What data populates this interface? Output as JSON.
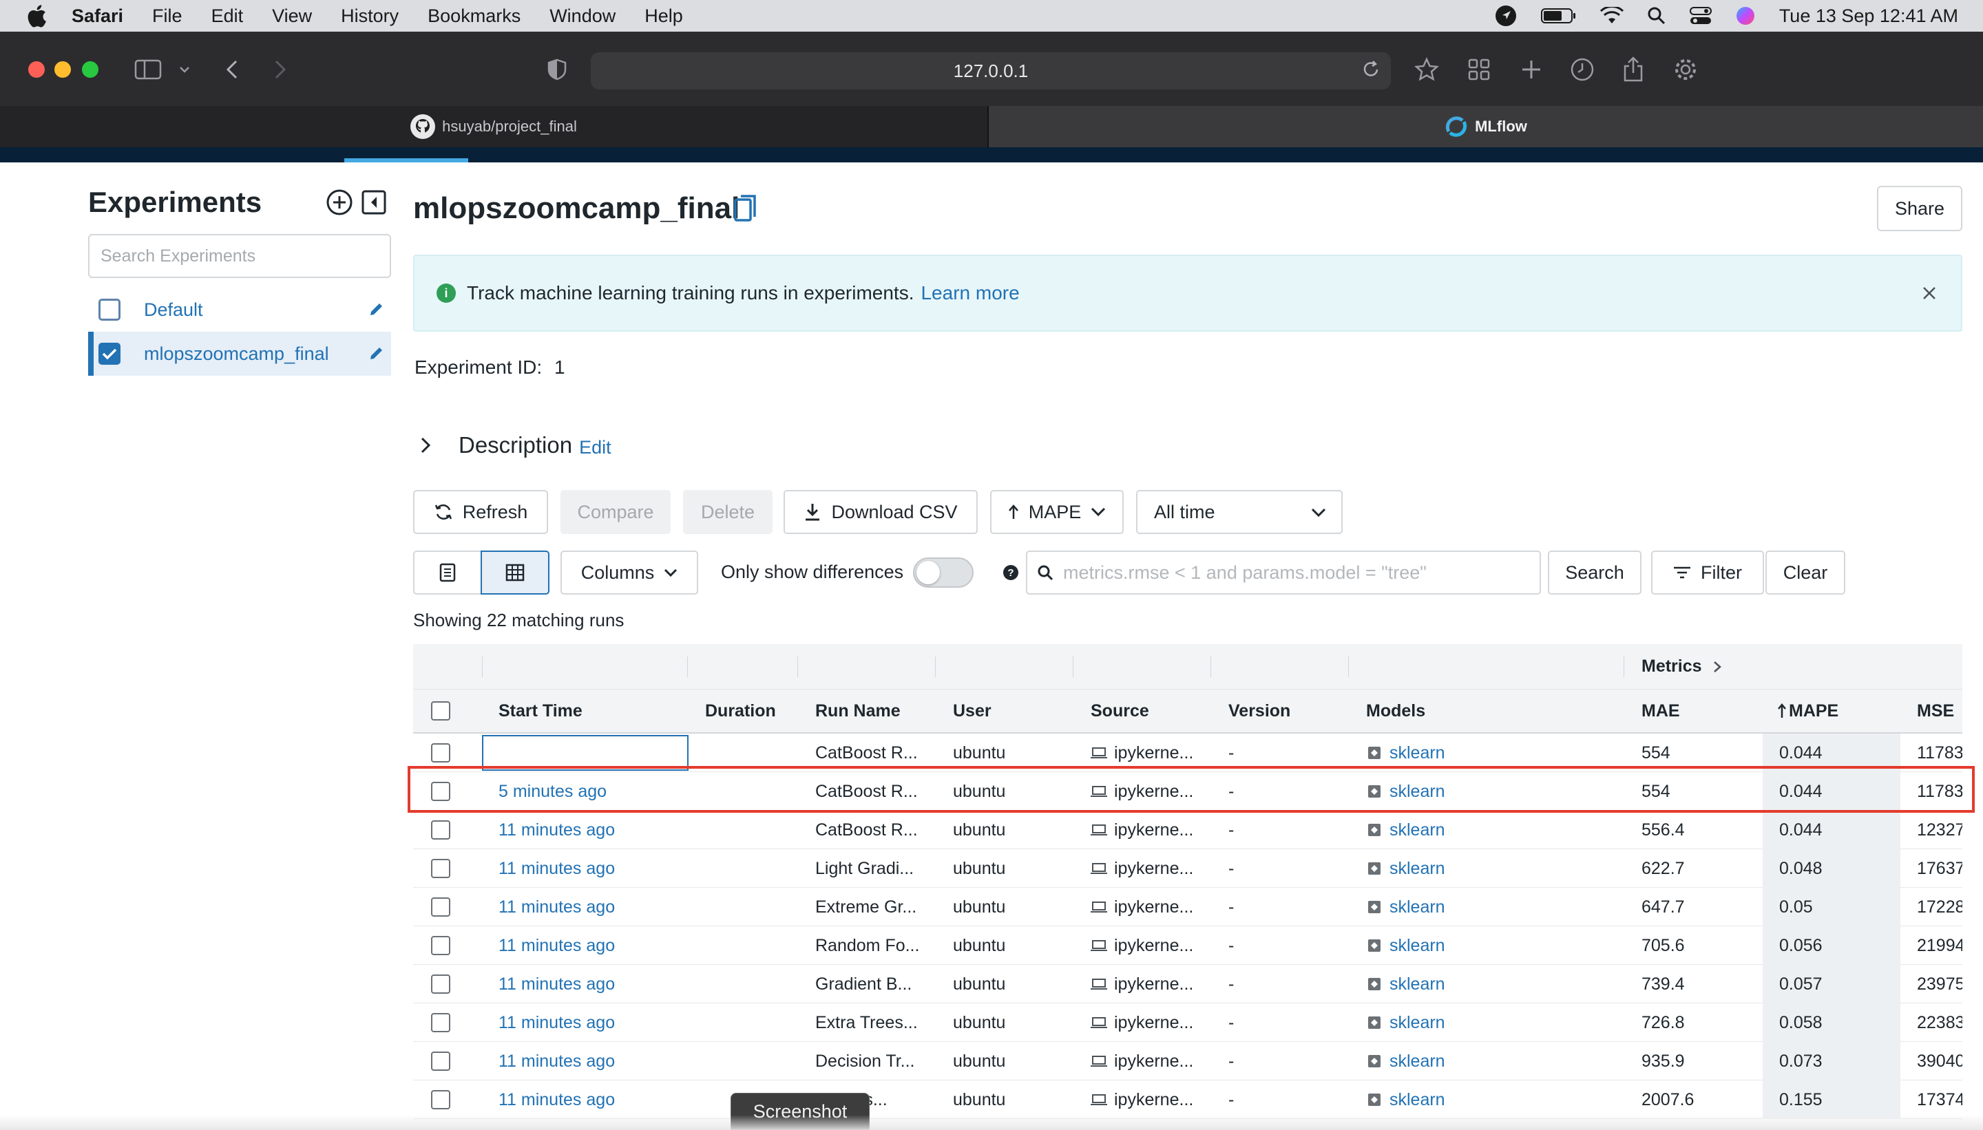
{
  "menubar": {
    "app": "Safari",
    "items": [
      "File",
      "Edit",
      "View",
      "History",
      "Bookmarks",
      "Window",
      "Help"
    ],
    "clock": "Tue 13 Sep  12:41 AM"
  },
  "browser": {
    "url": "127.0.0.1",
    "tabs": [
      {
        "label": "hsuyab/project_final",
        "icon": "github-icon"
      },
      {
        "label": "MLflow",
        "icon": "mlflow-icon"
      }
    ]
  },
  "sidebar": {
    "title": "Experiments",
    "search_placeholder": "Search Experiments",
    "items": [
      {
        "label": "Default",
        "checked": false
      },
      {
        "label": "mlopszoomcamp_final",
        "checked": true
      }
    ]
  },
  "main": {
    "title": "mlopszoomcamp_final",
    "share_label": "Share",
    "banner": {
      "text": "Track machine learning training runs in experiments.",
      "link": "Learn more"
    },
    "experiment_id_label": "Experiment ID:",
    "experiment_id": "1",
    "description_label": "Description",
    "edit_label": "Edit"
  },
  "controls": {
    "refresh": "Refresh",
    "compare": "Compare",
    "delete": "Delete",
    "download_csv": "Download CSV",
    "sort": "MAPE",
    "time_range": "All time",
    "columns": "Columns",
    "only_diff": "Only show differences",
    "only_diff_on": false,
    "search_placeholder": "metrics.rmse < 1 and params.model = \"tree\"",
    "search": "Search",
    "filter": "Filter",
    "clear": "Clear",
    "showing": "Showing 22 matching runs"
  },
  "table": {
    "group_header": "Metrics",
    "headers": [
      "Start Time",
      "Duration",
      "Run Name",
      "User",
      "Source",
      "Version",
      "Models",
      "MAE",
      "MAPE",
      "MSE"
    ],
    "rows": [
      {
        "start": "",
        "run": "CatBoost R...",
        "user": "ubuntu",
        "source": "ipykerne...",
        "version": "-",
        "model": "sklearn",
        "mae": "554",
        "mape": "0.044",
        "mse": "11783"
      },
      {
        "start": "5 minutes ago",
        "run": "CatBoost R...",
        "user": "ubuntu",
        "source": "ipykerne...",
        "version": "-",
        "model": "sklearn",
        "mae": "554",
        "mape": "0.044",
        "mse": "11783"
      },
      {
        "start": "11 minutes ago",
        "run": "CatBoost R...",
        "user": "ubuntu",
        "source": "ipykerne...",
        "version": "-",
        "model": "sklearn",
        "mae": "556.4",
        "mape": "0.044",
        "mse": "12327"
      },
      {
        "start": "11 minutes ago",
        "run": "Light Gradi...",
        "user": "ubuntu",
        "source": "ipykerne...",
        "version": "-",
        "model": "sklearn",
        "mae": "622.7",
        "mape": "0.048",
        "mse": "17637"
      },
      {
        "start": "11 minutes ago",
        "run": "Extreme Gr...",
        "user": "ubuntu",
        "source": "ipykerne...",
        "version": "-",
        "model": "sklearn",
        "mae": "647.7",
        "mape": "0.05",
        "mse": "17228"
      },
      {
        "start": "11 minutes ago",
        "run": "Random Fo...",
        "user": "ubuntu",
        "source": "ipykerne...",
        "version": "-",
        "model": "sklearn",
        "mae": "705.6",
        "mape": "0.056",
        "mse": "21994"
      },
      {
        "start": "11 minutes ago",
        "run": "Gradient B...",
        "user": "ubuntu",
        "source": "ipykerne...",
        "version": "-",
        "model": "sklearn",
        "mae": "739.4",
        "mape": "0.057",
        "mse": "23975"
      },
      {
        "start": "11 minutes ago",
        "run": "Extra Trees...",
        "user": "ubuntu",
        "source": "ipykerne...",
        "version": "-",
        "model": "sklearn",
        "mae": "726.8",
        "mape": "0.058",
        "mse": "22383"
      },
      {
        "start": "11 minutes ago",
        "run": "Decision Tr...",
        "user": "ubuntu",
        "source": "ipykerne...",
        "version": "-",
        "model": "sklearn",
        "mae": "935.9",
        "mape": "0.073",
        "mse": "39040"
      },
      {
        "start": "11 minutes ago",
        "run": "...Trans...",
        "user": "ubuntu",
        "source": "ipykerne...",
        "version": "-",
        "model": "sklearn",
        "mae": "2007.6",
        "mape": "0.155",
        "mse": "17374"
      }
    ]
  },
  "overlay": {
    "screenshot_label": "Screenshot"
  },
  "colors": {
    "accent": "#2272b4",
    "highlight": "#e33b2e",
    "header_bg": "#082138"
  }
}
